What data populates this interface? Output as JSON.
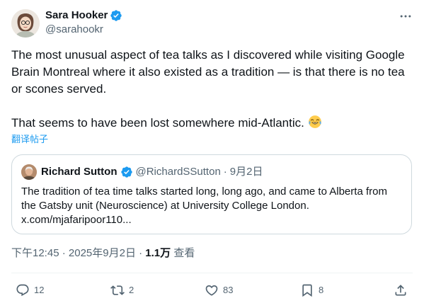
{
  "author": {
    "name": "Sara Hooker",
    "handle": "@sarahookr"
  },
  "tweet": {
    "paragraph1": "The most unusual aspect of tea talks as I discovered while visiting Google Brain Montreal where it also existed as a tradition — is that there is no tea or scones served.",
    "paragraph2": "That seems to have been lost somewhere mid-Atlantic.",
    "emoji": "😂",
    "translate_label": "翻译帖子"
  },
  "quote": {
    "name": "Richard Sutton",
    "handle": "@RichardSSutton",
    "separator": "·",
    "date": "9月2日",
    "line1": "The tradition of tea time talks started long, long ago, and came to Alberta from",
    "line2": "the Gatsby unit (Neuroscience) at University College London.",
    "line3": "x.com/mjafaripoor110..."
  },
  "meta": {
    "time": "下午12:45",
    "sep1": "·",
    "date": "2025年9月2日",
    "sep2": "·",
    "views_count": "1.1万",
    "views_label": "查看"
  },
  "actions": {
    "replies": "12",
    "reposts": "2",
    "likes": "83",
    "bookmarks": "8"
  },
  "icons": [
    "verified-badge-icon",
    "more-icon",
    "reply-icon",
    "repost-icon",
    "like-icon",
    "bookmark-icon",
    "share-icon",
    "tears-of-joy-emoji"
  ],
  "colors": {
    "verified": "#1d9bf0",
    "link": "#1d9bf0",
    "muted": "#536471",
    "border": "#cfd9de"
  }
}
